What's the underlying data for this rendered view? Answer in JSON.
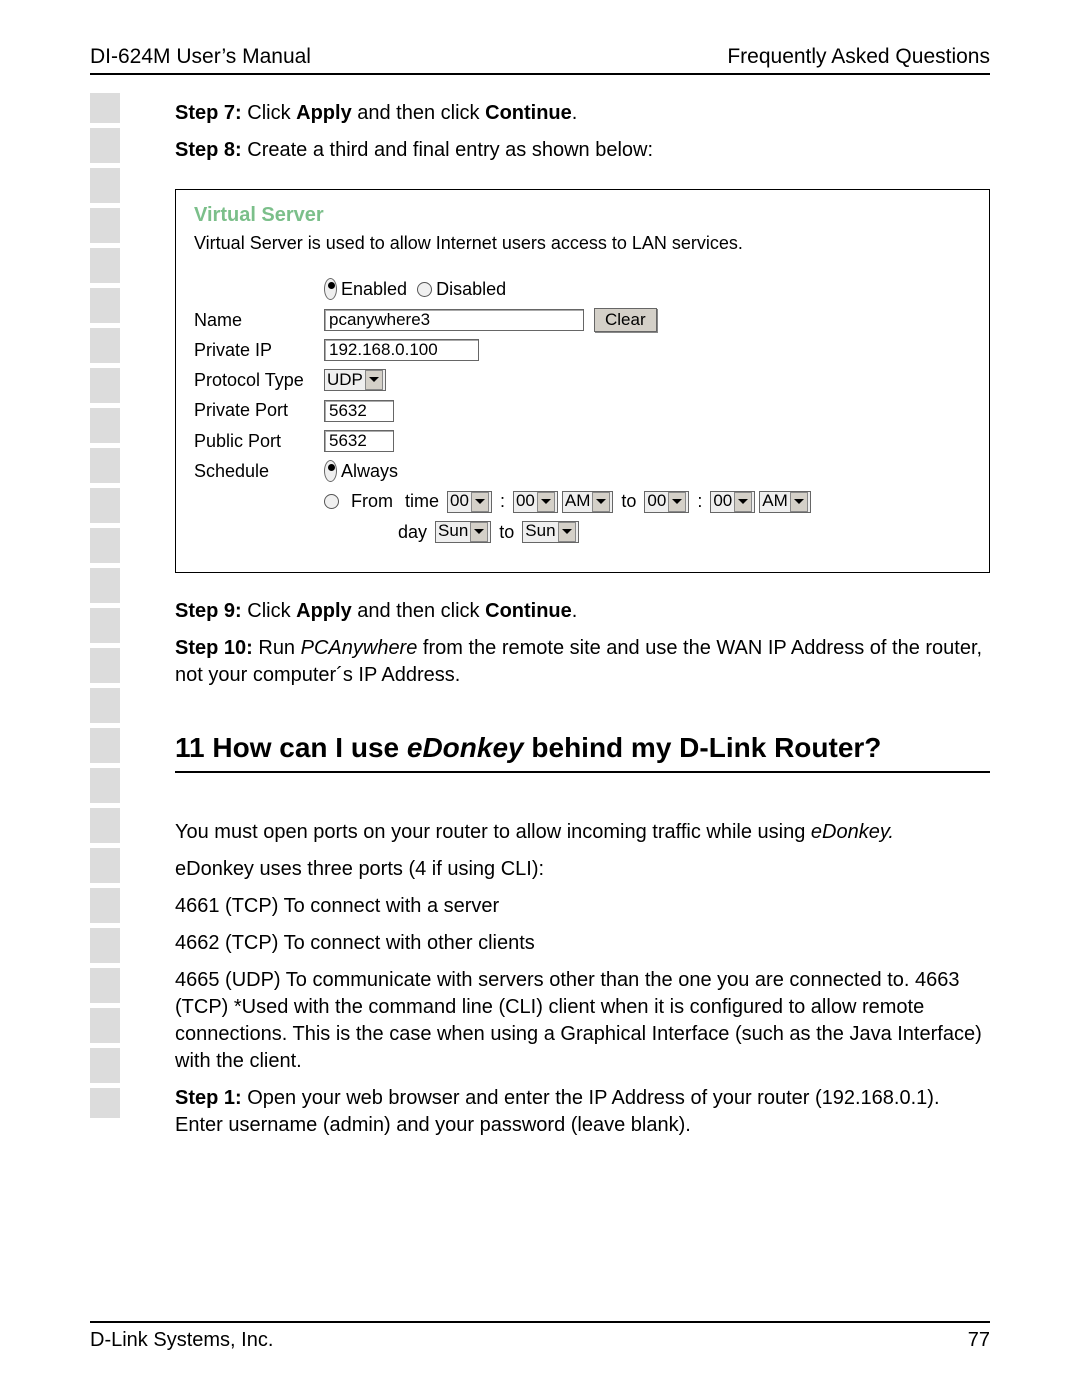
{
  "header": {
    "left": "DI-624M User’s Manual",
    "right": "Frequently Asked Questions"
  },
  "steps_a": {
    "s7_label": "Step 7:",
    "s7_text": " Click ",
    "s7_apply": "Apply",
    "s7_and": " and then click ",
    "s7_cont": "Continue",
    "s7_end": ".",
    "s8_label": "Step 8:",
    "s8_text": " Create a third and final entry as shown below:"
  },
  "vs": {
    "title": "Virtual Server",
    "desc": "Virtual Server is used to allow Internet users access to LAN services.",
    "enabled": "Enabled",
    "disabled": "Disabled",
    "name_label": "Name",
    "name_value": "pcanywhere3",
    "clear": "Clear",
    "pip_label": "Private IP",
    "pip_value": "192.168.0.100",
    "ptype_label": "Protocol Type",
    "ptype_value": "UDP",
    "pport_label": "Private Port",
    "pport_value": "5632",
    "pubport_label": "Public Port",
    "pubport_value": "5632",
    "sched_label": "Schedule",
    "always": "Always",
    "from": "From",
    "time": "time",
    "to": "to",
    "day": "day",
    "hh1": "00",
    "mm1": "00",
    "ap1": "AM",
    "hh2": "00",
    "mm2": "00",
    "ap2": "AM",
    "day1": "Sun",
    "day2": "Sun"
  },
  "steps_b": {
    "s9_label": "Step 9:",
    "s9_text": " Click ",
    "s9_apply": "Apply",
    "s9_and": " and then click ",
    "s9_cont": "Continue",
    "s9_end": ".",
    "s10_label": "Step 10:",
    "s10_a": " Run ",
    "s10_pca": "PCAnywhere",
    "s10_b": " from the remote site and use the WAN IP Address of the router, not your computer´s IP Address."
  },
  "q": {
    "num": "11",
    "a": " How can I use ",
    "ed": "eDonkey",
    "b": " behind my D-Link Router?"
  },
  "body": {
    "p1a": "You must open ports on your router to allow incoming traffic while using ",
    "p1b": "eDonkey.",
    "p2": "eDonkey uses three ports (4 if using CLI):",
    "p3": "4661 (TCP) To connect with a server",
    "p4": "4662 (TCP) To connect with other clients",
    "p5": "4665 (UDP) To communicate with servers other than the one you are connected to. 4663 (TCP) *Used with the command line (CLI) client when it is configured to allow remote connections. This is the case when using a Graphical Interface (such as the Java Interface) with the client.",
    "s1_label": "Step 1:",
    "s1_text": " Open your web browser and enter the IP Address of your router (192.168.0.1). Enter username (admin) and your password (leave blank)."
  },
  "footer": {
    "left": "D-Link Systems, Inc.",
    "right": "77"
  }
}
